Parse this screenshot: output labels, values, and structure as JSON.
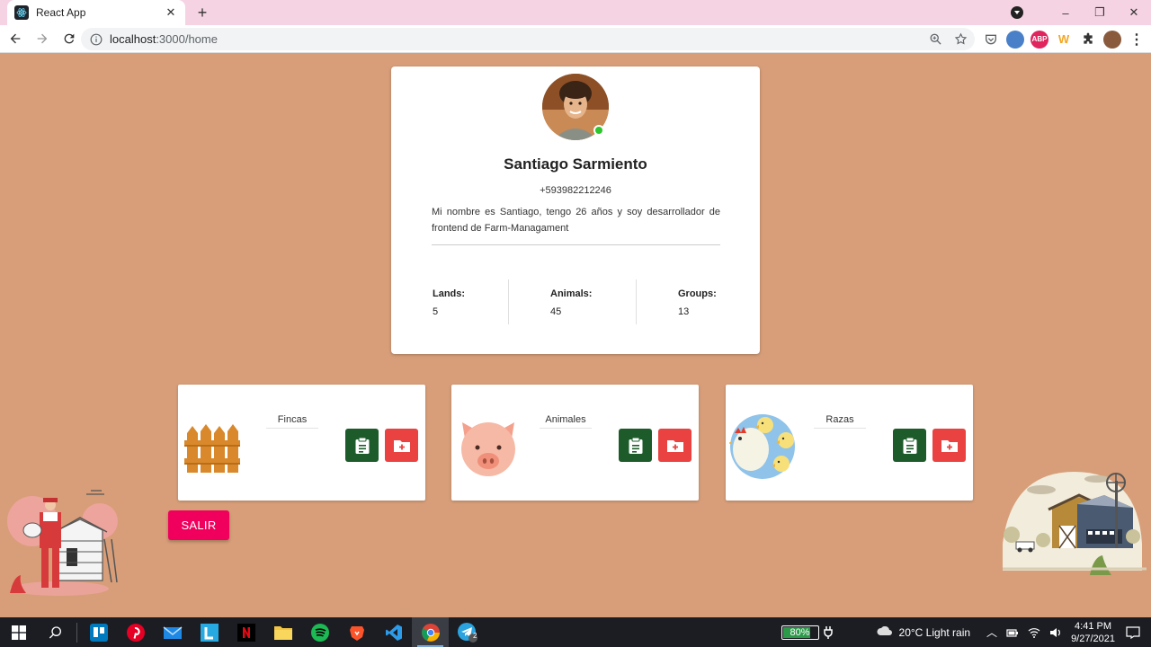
{
  "browser": {
    "tab_title": "React App",
    "tab_close": "✕",
    "new_tab": "+",
    "url_host": "localhost",
    "url_path": ":3000/home",
    "window_controls": {
      "minimize": "–",
      "maximize": "❐",
      "close": "✕"
    },
    "extensions": [
      {
        "name": "pocket-icon",
        "color": "#ef4056",
        "label": ""
      },
      {
        "name": "world-icon",
        "color": "#4a80c8",
        "label": ""
      },
      {
        "name": "adblock-icon",
        "color": "#e0245e",
        "label": "ABP"
      },
      {
        "name": "wunderlist-icon",
        "color": "#f5a623",
        "label": "W"
      }
    ]
  },
  "profile": {
    "name": "Santiago Sarmiento",
    "phone": "+593982212246",
    "bio": "Mi nombre es Santiago, tengo 26 años y soy desarrollador de frontend de Farm-Managament",
    "online": true,
    "stats": [
      {
        "label": "Lands:",
        "value": "5"
      },
      {
        "label": "Animals:",
        "value": "45"
      },
      {
        "label": "Groups:",
        "value": "13"
      }
    ]
  },
  "categories": [
    {
      "title": "Fincas",
      "icon": "fence-icon"
    },
    {
      "title": "Animales",
      "icon": "pig-icon"
    },
    {
      "title": "Razas",
      "icon": "chickens-icon"
    }
  ],
  "logout_label": "SALIR",
  "taskbar": {
    "battery": "80%",
    "battery_level": 0.8,
    "weather": "20°C  Light rain",
    "time": "4:41 PM",
    "date": "9/27/2021",
    "telegram_badge": "2"
  },
  "colors": {
    "page_background": "#d79e79",
    "list_button": "#1d5c2a",
    "add_button": "#e94241",
    "logout_button": "#f0005c",
    "online": "#2ec52e"
  }
}
